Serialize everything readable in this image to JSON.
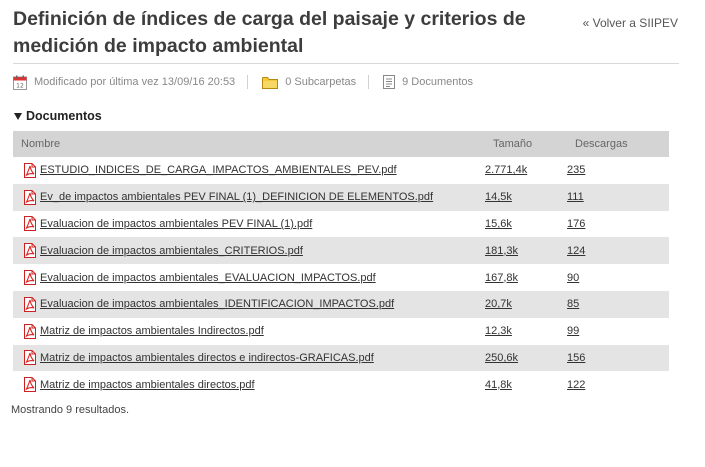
{
  "page": {
    "title": "Definición de índices de carga del paisaje y criterios de medición de impacto ambiental",
    "back_link": "« Volver a SIIPEV"
  },
  "meta": {
    "modified": "Modificado por última vez 13/09/16 20:53",
    "subfolders": "0 Subcarpetas",
    "documents": "9 Documentos"
  },
  "section": {
    "label": "Documentos"
  },
  "table": {
    "headers": {
      "name": "Nombre",
      "size": "Tamaño",
      "downloads": "Descargas"
    },
    "rows": [
      {
        "name": "ESTUDIO_INDICES_DE_CARGA_IMPACTOS_AMBIENTALES_PEV.pdf",
        "size": "2.771,4k",
        "downloads": "235"
      },
      {
        "name": "Ev_de impactos ambientales PEV FINAL (1)_DEFINICION DE ELEMENTOS.pdf",
        "size": "14,5k",
        "downloads": "111"
      },
      {
        "name": "Evaluacion de impactos ambientales PEV FINAL (1).pdf",
        "size": "15,6k",
        "downloads": "176"
      },
      {
        "name": "Evaluacion de impactos ambientales_CRITERIOS.pdf",
        "size": "181,3k",
        "downloads": "124"
      },
      {
        "name": "Evaluacion de impactos ambientales_EVALUACION_IMPACTOS.pdf",
        "size": "167,8k",
        "downloads": "90"
      },
      {
        "name": "Evaluacion de impactos ambientales_IDENTIFICACION_IMPACTOS.pdf",
        "size": "20,7k",
        "downloads": "85"
      },
      {
        "name": "Matriz de impactos ambientales Indirectos.pdf",
        "size": "12,3k",
        "downloads": "99"
      },
      {
        "name": "Matriz de impactos ambientales directos e indirectos-GRAFICAS.pdf",
        "size": "250,6k",
        "downloads": "156"
      },
      {
        "name": "Matriz de impactos ambientales directos.pdf",
        "size": "41,8k",
        "downloads": "122"
      }
    ]
  },
  "results_text": "Mostrando 9 resultados.",
  "icons": {
    "calendar": "calendar-icon",
    "folder": "folder-icon",
    "document": "document-icon",
    "pdf": "pdf-icon"
  },
  "colors": {
    "pdf_red": "#cc2222",
    "folder_yellow": "#e8b422",
    "header_bg": "#d4d4d4",
    "alt_row_bg": "#e4e4e4"
  }
}
